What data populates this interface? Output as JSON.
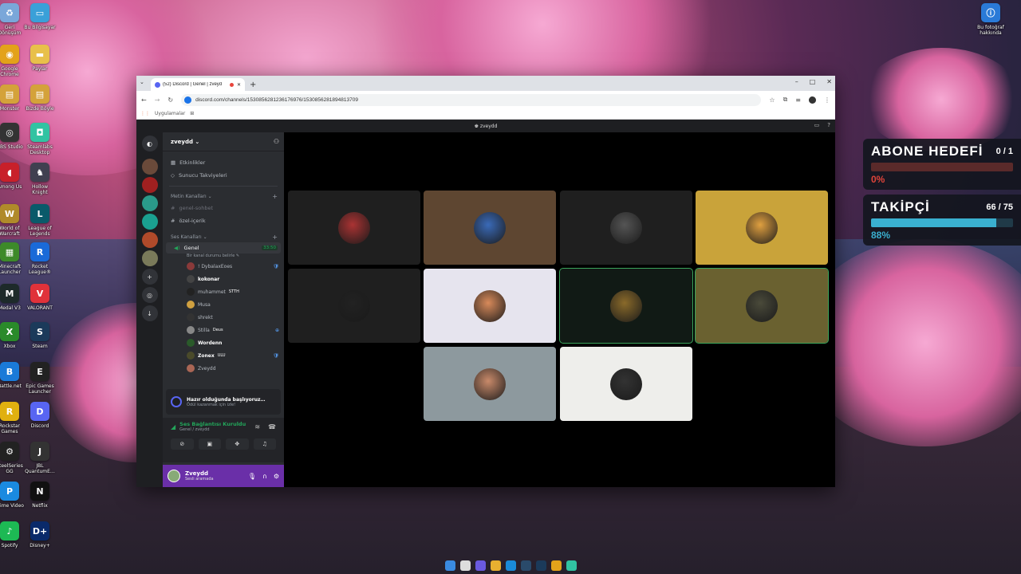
{
  "desktop": {
    "icons": [
      {
        "label": "Geri\nDönüşüm",
        "glyph": "♻",
        "color": "#7aa7d9"
      },
      {
        "label": "Bu Bilgisayar",
        "glyph": "▭",
        "color": "#3aa0d8"
      },
      {
        "label": "Google\nChrome",
        "glyph": "◉",
        "color": "#e3a21a"
      },
      {
        "label": "Paylar",
        "glyph": "▬",
        "color": "#e8c04a"
      },
      {
        "label": "Monster",
        "glyph": "▤",
        "color": "#d4a23a"
      },
      {
        "label": "Bizde Böyle",
        "glyph": "▤",
        "color": "#d4a23a"
      },
      {
        "label": "OBS Studio",
        "glyph": "◎",
        "color": "#333333"
      },
      {
        "label": "Steamlabs\nDesktop",
        "glyph": "◘",
        "color": "#31c3a2"
      },
      {
        "label": "Among Us",
        "glyph": "◖",
        "color": "#c8202a"
      },
      {
        "label": "Hollow\nKnight",
        "glyph": "♞",
        "color": "#404050"
      },
      {
        "label": "World of\nWarcraft",
        "glyph": "W",
        "color": "#b08a2a"
      },
      {
        "label": "League of\nLegends",
        "glyph": "L",
        "color": "#0a5a6a"
      },
      {
        "label": "Minecraft\nLauncher",
        "glyph": "▦",
        "color": "#3d8a2a"
      },
      {
        "label": "Rocket\nLeague®",
        "glyph": "R",
        "color": "#1a6ad8"
      },
      {
        "label": "Medal V3",
        "glyph": "M",
        "color": "#1d2a2a"
      },
      {
        "label": "VALORANT",
        "glyph": "V",
        "color": "#e0323a"
      },
      {
        "label": "Xbox",
        "glyph": "X",
        "color": "#2a8a2a"
      },
      {
        "label": "Steam",
        "glyph": "S",
        "color": "#1b3a5a"
      },
      {
        "label": "Battle.net",
        "glyph": "B",
        "color": "#1a7ad8"
      },
      {
        "label": "Epic Games\nLauncher",
        "glyph": "E",
        "color": "#222222"
      },
      {
        "label": "Rockstar\nGames",
        "glyph": "R",
        "color": "#e0b010"
      },
      {
        "label": "Discord",
        "glyph": "D",
        "color": "#5865f2"
      },
      {
        "label": "SteelSeries\nGG",
        "glyph": "⚙",
        "color": "#222222"
      },
      {
        "label": "JBL\nQuantumE…",
        "glyph": "J",
        "color": "#333333"
      },
      {
        "label": "Prime Video",
        "glyph": "P",
        "color": "#1a8ae0"
      },
      {
        "label": "Netflix",
        "glyph": "N",
        "color": "#111111"
      },
      {
        "label": "Spotify",
        "glyph": "♪",
        "color": "#1db954"
      },
      {
        "label": "Disney+",
        "glyph": "D+",
        "color": "#0a2a6a"
      },
      {
        "label": "Bu fotoğraf\nhakkında",
        "glyph": "ⓘ",
        "color": "#2a7ad8"
      }
    ]
  },
  "browser": {
    "tab_title": "(52) Discord | Genel | zveyd",
    "url": "discord.com/channels/1530856281236176976/1530856281894813709",
    "bookmark": "Uygulamalar",
    "window_controls": [
      "–",
      "□",
      "✕"
    ]
  },
  "discord": {
    "window_title": "zveydd",
    "server_name": "zveydd",
    "top_items": [
      "Etkinlikler",
      "Sunucu Takviyeleri"
    ],
    "text_category": "Metin Kanalları",
    "text_channels": [
      "genel-sohbet",
      "özel-içerik"
    ],
    "voice_category": "Ses Kanalları",
    "voice_channel": "Genel",
    "voice_timer": "33:50",
    "voice_status": "Bir kanal durumu belirle",
    "members": [
      {
        "name": "! DybalaxEoes",
        "badge": "🛡",
        "color": "#8a3a3a"
      },
      {
        "name": "kokonar",
        "badge": "",
        "color": "#444"
      },
      {
        "name": "muhammet",
        "tag": "STTH",
        "badge": "",
        "color": "#222"
      },
      {
        "name": "Musa",
        "badge": "",
        "color": "#d0a040"
      },
      {
        "name": "shrekt",
        "badge": "",
        "color": "#333"
      },
      {
        "name": "Stilla",
        "tag": "Deus",
        "badge": "⊕",
        "color": "#888"
      },
      {
        "name": "Wordenn",
        "badge": "",
        "color": "#2a5a2a"
      },
      {
        "name": "Zonex",
        "tag": "ULU",
        "badge": "🛡",
        "color": "#4a4a2a"
      },
      {
        "name": "Zveydd",
        "badge": "",
        "color": "#aa6655"
      }
    ],
    "ribbon_title": "Hazır olduğunda başlıyoruz…",
    "ribbon_sub": "Ödül kazanmak için izle!",
    "voice_connected": "Ses Bağlantısı Kuruldu",
    "voice_location": "Genel / zveydd",
    "user_name": "Zveydd",
    "user_status": "Sesli aramada"
  },
  "tiles": [
    {
      "bg": "#1f1f1f",
      "avatar": "#a33",
      "speaking": false
    },
    {
      "bg": "#5e4631",
      "avatar": "#3a6ab8",
      "speaking": false
    },
    {
      "bg": "#1f1f1f",
      "avatar": "#555",
      "speaking": false
    },
    {
      "bg": "#c9a33a",
      "avatar": "#e0a040",
      "speaking": false
    },
    {
      "bg": "#1f1f1f",
      "avatar": "#222",
      "speaking": false
    },
    {
      "bg": "#e6e4ee",
      "avatar": "#d88a5a",
      "speaking": false
    },
    {
      "bg": "#111a15",
      "avatar": "#8a6a2a",
      "speaking": true
    },
    {
      "bg": "#6a6130",
      "avatar": "#4a4a3a",
      "speaking": true
    },
    {
      "bg": "#8d999e",
      "avatar": "#c98a6a",
      "speaking": false
    },
    {
      "bg": "#eeeeeb",
      "avatar": "#333",
      "speaking": false
    }
  ],
  "goals": [
    {
      "name": "ABONE HEDEFİ",
      "count": "0 / 1",
      "percent": "0%",
      "fraction": 0.0,
      "bar_bg": "#5a2a2a",
      "fill": "#e0443a",
      "pct_color": "#e0443a"
    },
    {
      "name": "TAKİPÇİ",
      "count": "66 / 75",
      "percent": "88%",
      "fraction": 0.88,
      "bar_bg": "#203a48",
      "fill": "#3ab0d0",
      "pct_color": "#3ab0d0"
    }
  ]
}
